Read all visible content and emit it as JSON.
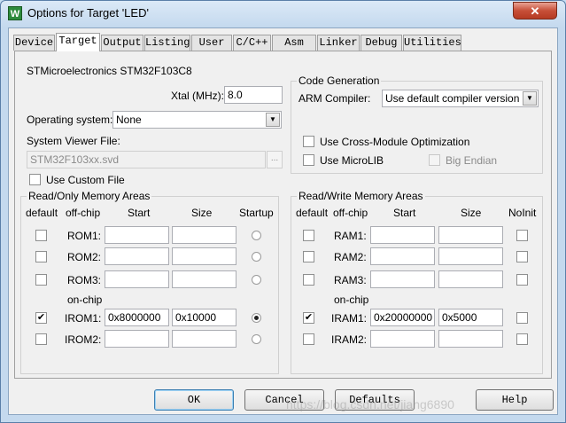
{
  "window": {
    "title": "Options for Target 'LED'",
    "icon": "W",
    "close": "✕"
  },
  "tabs": [
    {
      "label": "Device"
    },
    {
      "label": "Target"
    },
    {
      "label": "Output"
    },
    {
      "label": "Listing"
    },
    {
      "label": "User"
    },
    {
      "label": "C/C++"
    },
    {
      "label": "Asm"
    },
    {
      "label": "Linker"
    },
    {
      "label": "Debug"
    },
    {
      "label": "Utilities"
    }
  ],
  "active_tab": "Target",
  "target": {
    "device_name": "STMicroelectronics STM32F103C8",
    "xtal_label": "Xtal (MHz):",
    "xtal_value": "8.0",
    "os_label": "Operating system:",
    "os_value": "None",
    "svd_label": "System Viewer File:",
    "svd_value": "STM32F103xx.svd",
    "browse_label": "...",
    "use_custom_file": "Use Custom File"
  },
  "code_generation": {
    "title": "Code Generation",
    "compiler_label": "ARM Compiler:",
    "compiler_value": "Use default compiler version",
    "cross_module": "Use Cross-Module Optimization",
    "microlib": "Use MicroLIB",
    "big_endian": "Big Endian"
  },
  "rom": {
    "title": "Read/Only Memory Areas",
    "headers": {
      "default": "default",
      "offchip": "off-chip",
      "start": "Start",
      "size": "Size",
      "startup": "Startup"
    },
    "onchip_label": "on-chip",
    "rows": [
      {
        "label": "ROM1:",
        "start": "",
        "size": "",
        "checked": "",
        "startup": false
      },
      {
        "label": "ROM2:",
        "start": "",
        "size": "",
        "checked": "",
        "startup": false
      },
      {
        "label": "ROM3:",
        "start": "",
        "size": "",
        "checked": "",
        "startup": false
      },
      {
        "label": "IROM1:",
        "start": "0x8000000",
        "size": "0x10000",
        "checked": "✔",
        "startup": true
      },
      {
        "label": "IROM2:",
        "start": "",
        "size": "",
        "checked": "",
        "startup": false
      }
    ]
  },
  "ram": {
    "title": "Read/Write Memory Areas",
    "headers": {
      "default": "default",
      "offchip": "off-chip",
      "start": "Start",
      "size": "Size",
      "noinit": "NoInit"
    },
    "onchip_label": "on-chip",
    "rows": [
      {
        "label": "RAM1:",
        "start": "",
        "size": "",
        "checked": ""
      },
      {
        "label": "RAM2:",
        "start": "",
        "size": "",
        "checked": ""
      },
      {
        "label": "RAM3:",
        "start": "",
        "size": "",
        "checked": ""
      },
      {
        "label": "IRAM1:",
        "start": "0x20000000",
        "size": "0x5000",
        "checked": "✔"
      },
      {
        "label": "IRAM2:",
        "start": "",
        "size": "",
        "checked": ""
      }
    ]
  },
  "buttons": {
    "ok": "OK",
    "cancel": "Cancel",
    "defaults": "Defaults",
    "help": "Help"
  },
  "watermark": "https://blog.csdn.net/jiang6890"
}
